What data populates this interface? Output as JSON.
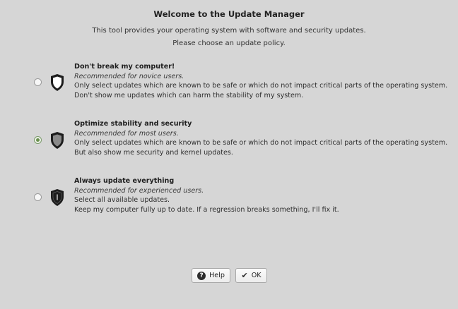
{
  "header": {
    "title": "Welcome to the Update Manager",
    "subtitle_line1": "This tool provides your operating system with software and security updates.",
    "subtitle_line2": "Please choose an update policy."
  },
  "options": [
    {
      "title": "Don't break my computer!",
      "recommended": "Recommended for novice users.",
      "desc1": "Only select updates which are known to be safe or which do not impact critical parts of the operating system.",
      "desc2": "Don't show me updates which can harm the stability of my system.",
      "selected": false,
      "icon": "shield-white-icon"
    },
    {
      "title": "Optimize stability and security",
      "recommended": "Recommended for most users.",
      "desc1": "Only select updates which are known to be safe or which do not impact critical parts of the operating system.",
      "desc2": "But also show me security and kernel updates.",
      "selected": true,
      "icon": "shield-gray-icon"
    },
    {
      "title": "Always update everything",
      "recommended": "Recommended for experienced users.",
      "desc1": "Select all available updates.",
      "desc2": "Keep my computer fully up to date. If a regression breaks something, I'll fix it.",
      "selected": false,
      "icon": "shield-black-icon"
    }
  ],
  "buttons": {
    "help_label": "Help",
    "ok_label": "OK"
  },
  "colors": {
    "background": "#d6d6d6",
    "selected_radio": "#6a8f4e"
  }
}
